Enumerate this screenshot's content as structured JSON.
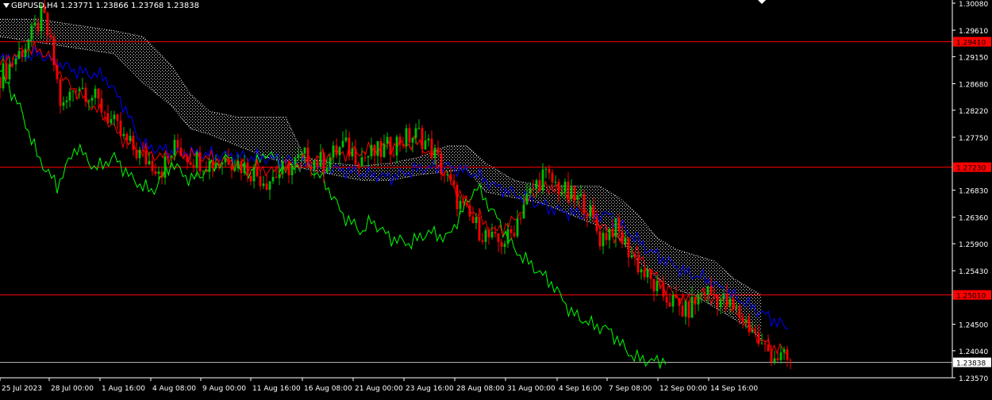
{
  "header": {
    "symbol": "GBPUSD,H4",
    "ohlc": "1.23771 1.23866 1.23768 1.23838"
  },
  "colors": {
    "background": "#000000",
    "bull_candle": "#00c000",
    "bear_candle": "#ff0000",
    "tenkan": "#ff0000",
    "kijun": "#0000ff",
    "chikou": "#00ff00",
    "kumo": "#ffffff",
    "hline": "#ff0000",
    "price_line": "#c0c0c0",
    "axis": "#ffffff"
  },
  "chart_data": {
    "type": "candlestick",
    "indicator": "Ichimoku Kinko Hyo",
    "ylim": [
      1.2357,
      1.3008
    ],
    "y_ticks": [
      {
        "value": 1.3008,
        "label": "1.30080"
      },
      {
        "value": 1.2961,
        "label": "1.29610"
      },
      {
        "value": 1.2915,
        "label": "1.29150"
      },
      {
        "value": 1.2868,
        "label": "1.28680"
      },
      {
        "value": 1.2822,
        "label": "1.28220"
      },
      {
        "value": 1.2775,
        "label": "1.27750"
      },
      {
        "value": 1.2683,
        "label": "1.26830"
      },
      {
        "value": 1.2636,
        "label": "1.26360"
      },
      {
        "value": 1.259,
        "label": "1.25900"
      },
      {
        "value": 1.2543,
        "label": "1.25430"
      },
      {
        "value": 1.245,
        "label": "1.24500"
      },
      {
        "value": 1.2404,
        "label": "1.24040"
      },
      {
        "value": 1.2357,
        "label": "1.23570"
      }
    ],
    "x_ticks": [
      "25 Jul 2023",
      "28 Jul 00:00",
      "1 Aug 16:00",
      "4 Aug 08:00",
      "9 Aug 00:00",
      "11 Aug 16:00",
      "16 Aug 08:00",
      "21 Aug 00:00",
      "23 Aug 16:00",
      "28 Aug 08:00",
      "31 Aug 00:00",
      "4 Sep 16:00",
      "7 Sep 08:00",
      "12 Sep 00:00",
      "14 Sep 16:00"
    ],
    "horizontal_lines": [
      {
        "value": 1.2941,
        "label": "1.29410"
      },
      {
        "value": 1.2723,
        "label": "1.27230"
      },
      {
        "value": 1.2501,
        "label": "1.25010"
      }
    ],
    "current_price": {
      "value": 1.23838,
      "label": "1.23838"
    },
    "close_path": [
      [
        0,
        1.288
      ],
      [
        0.02,
        1.292
      ],
      [
        0.035,
        1.2955
      ],
      [
        0.045,
        1.299
      ],
      [
        0.055,
        1.292
      ],
      [
        0.065,
        1.282
      ],
      [
        0.08,
        1.287
      ],
      [
        0.095,
        1.285
      ],
      [
        0.11,
        1.282
      ],
      [
        0.13,
        1.277
      ],
      [
        0.15,
        1.274
      ],
      [
        0.17,
        1.272
      ],
      [
        0.185,
        1.276
      ],
      [
        0.2,
        1.274
      ],
      [
        0.22,
        1.273
      ],
      [
        0.24,
        1.274
      ],
      [
        0.26,
        1.272
      ],
      [
        0.28,
        1.27
      ],
      [
        0.3,
        1.272
      ],
      [
        0.32,
        1.274
      ],
      [
        0.34,
        1.273
      ],
      [
        0.36,
        1.276
      ],
      [
        0.38,
        1.274
      ],
      [
        0.4,
        1.275
      ],
      [
        0.42,
        1.277
      ],
      [
        0.44,
        1.278
      ],
      [
        0.455,
        1.275
      ],
      [
        0.47,
        1.27
      ],
      [
        0.485,
        1.265
      ],
      [
        0.5,
        1.262
      ],
      [
        0.52,
        1.259
      ],
      [
        0.535,
        1.26
      ],
      [
        0.55,
        1.266
      ],
      [
        0.57,
        1.271
      ],
      [
        0.585,
        1.269
      ],
      [
        0.6,
        1.267
      ],
      [
        0.615,
        1.266
      ],
      [
        0.63,
        1.26
      ],
      [
        0.645,
        1.262
      ],
      [
        0.66,
        1.258
      ],
      [
        0.675,
        1.254
      ],
      [
        0.69,
        1.251
      ],
      [
        0.705,
        1.249
      ],
      [
        0.72,
        1.247
      ],
      [
        0.74,
        1.251
      ],
      [
        0.76,
        1.249
      ],
      [
        0.775,
        1.247
      ],
      [
        0.79,
        1.244
      ],
      [
        0.8,
        1.241
      ],
      [
        0.815,
        1.2395
      ],
      [
        0.83,
        1.2384
      ]
    ],
    "tenkan_path": [
      [
        0,
        1.29
      ],
      [
        0.03,
        1.293
      ],
      [
        0.05,
        1.292
      ],
      [
        0.07,
        1.287
      ],
      [
        0.09,
        1.284
      ],
      [
        0.11,
        1.281
      ],
      [
        0.13,
        1.277
      ],
      [
        0.15,
        1.275
      ],
      [
        0.17,
        1.274
      ],
      [
        0.2,
        1.2745
      ],
      [
        0.23,
        1.2735
      ],
      [
        0.26,
        1.2725
      ],
      [
        0.29,
        1.2715
      ],
      [
        0.32,
        1.2735
      ],
      [
        0.35,
        1.2745
      ],
      [
        0.38,
        1.275
      ],
      [
        0.41,
        1.276
      ],
      [
        0.44,
        1.2765
      ],
      [
        0.46,
        1.273
      ],
      [
        0.48,
        1.268
      ],
      [
        0.5,
        1.264
      ],
      [
        0.52,
        1.261
      ],
      [
        0.54,
        1.263
      ],
      [
        0.56,
        1.268
      ],
      [
        0.58,
        1.269
      ],
      [
        0.6,
        1.267
      ],
      [
        0.62,
        1.264
      ],
      [
        0.64,
        1.261
      ],
      [
        0.66,
        1.259
      ],
      [
        0.68,
        1.255
      ],
      [
        0.7,
        1.251
      ],
      [
        0.72,
        1.249
      ],
      [
        0.74,
        1.25
      ],
      [
        0.76,
        1.249
      ],
      [
        0.78,
        1.246
      ],
      [
        0.8,
        1.242
      ],
      [
        0.82,
        1.2405
      ],
      [
        0.83,
        1.2398
      ]
    ],
    "kijun_path": [
      [
        0,
        1.291
      ],
      [
        0.04,
        1.292
      ],
      [
        0.08,
        1.289
      ],
      [
        0.11,
        1.288
      ],
      [
        0.13,
        1.283
      ],
      [
        0.15,
        1.276
      ],
      [
        0.18,
        1.275
      ],
      [
        0.22,
        1.2745
      ],
      [
        0.27,
        1.274
      ],
      [
        0.3,
        1.2735
      ],
      [
        0.33,
        1.2725
      ],
      [
        0.37,
        1.2715
      ],
      [
        0.41,
        1.2705
      ],
      [
        0.44,
        1.272
      ],
      [
        0.47,
        1.2725
      ],
      [
        0.5,
        1.271
      ],
      [
        0.52,
        1.269
      ],
      [
        0.55,
        1.267
      ],
      [
        0.58,
        1.265
      ],
      [
        0.61,
        1.264
      ],
      [
        0.64,
        1.264
      ],
      [
        0.66,
        1.261
      ],
      [
        0.68,
        1.258
      ],
      [
        0.7,
        1.256
      ],
      [
        0.72,
        1.254
      ],
      [
        0.74,
        1.253
      ],
      [
        0.76,
        1.251
      ],
      [
        0.78,
        1.249
      ],
      [
        0.8,
        1.247
      ],
      [
        0.83,
        1.244
      ]
    ],
    "chikou_path": [
      [
        0,
        1.289
      ],
      [
        0.02,
        1.283
      ],
      [
        0.04,
        1.274
      ],
      [
        0.06,
        1.269
      ],
      [
        0.08,
        1.276
      ],
      [
        0.1,
        1.272
      ],
      [
        0.12,
        1.274
      ],
      [
        0.14,
        1.27
      ],
      [
        0.16,
        1.268
      ],
      [
        0.18,
        1.273
      ],
      [
        0.2,
        1.27
      ],
      [
        0.22,
        1.272
      ],
      [
        0.24,
        1.274
      ],
      [
        0.26,
        1.271
      ],
      [
        0.28,
        1.275
      ],
      [
        0.3,
        1.272
      ],
      [
        0.32,
        1.273
      ],
      [
        0.34,
        1.27
      ],
      [
        0.36,
        1.264
      ],
      [
        0.38,
        1.261
      ],
      [
        0.39,
        1.263
      ],
      [
        0.41,
        1.26
      ],
      [
        0.43,
        1.259
      ],
      [
        0.45,
        1.261
      ],
      [
        0.47,
        1.26
      ],
      [
        0.49,
        1.266
      ],
      [
        0.5,
        1.269
      ],
      [
        0.52,
        1.264
      ],
      [
        0.54,
        1.258
      ],
      [
        0.56,
        1.255
      ],
      [
        0.58,
        1.252
      ],
      [
        0.6,
        1.247
      ],
      [
        0.62,
        1.245
      ],
      [
        0.64,
        1.244
      ],
      [
        0.66,
        1.24
      ],
      [
        0.67,
        1.239
      ],
      [
        0.69,
        1.2385
      ],
      [
        0.7,
        1.239
      ]
    ],
    "kumo": [
      {
        "x": 0.0,
        "top": 1.298,
        "bottom": 1.295
      },
      {
        "x": 0.04,
        "top": 1.298,
        "bottom": 1.294
      },
      {
        "x": 0.08,
        "top": 1.297,
        "bottom": 1.293
      },
      {
        "x": 0.12,
        "top": 1.296,
        "bottom": 1.292
      },
      {
        "x": 0.15,
        "top": 1.295,
        "bottom": 1.287
      },
      {
        "x": 0.18,
        "top": 1.29,
        "bottom": 1.283
      },
      {
        "x": 0.2,
        "top": 1.285,
        "bottom": 1.279
      },
      {
        "x": 0.22,
        "top": 1.282,
        "bottom": 1.278
      },
      {
        "x": 0.25,
        "top": 1.281,
        "bottom": 1.276
      },
      {
        "x": 0.28,
        "top": 1.281,
        "bottom": 1.274
      },
      {
        "x": 0.3,
        "top": 1.281,
        "bottom": 1.273
      },
      {
        "x": 0.32,
        "top": 1.274,
        "bottom": 1.272
      },
      {
        "x": 0.35,
        "top": 1.273,
        "bottom": 1.271
      },
      {
        "x": 0.38,
        "top": 1.2725,
        "bottom": 1.27
      },
      {
        "x": 0.41,
        "top": 1.273,
        "bottom": 1.27
      },
      {
        "x": 0.44,
        "top": 1.274,
        "bottom": 1.271
      },
      {
        "x": 0.47,
        "top": 1.276,
        "bottom": 1.2715
      },
      {
        "x": 0.49,
        "top": 1.276,
        "bottom": 1.272
      },
      {
        "x": 0.51,
        "top": 1.273,
        "bottom": 1.268
      },
      {
        "x": 0.54,
        "top": 1.27,
        "bottom": 1.267
      },
      {
        "x": 0.57,
        "top": 1.269,
        "bottom": 1.266
      },
      {
        "x": 0.6,
        "top": 1.269,
        "bottom": 1.264
      },
      {
        "x": 0.63,
        "top": 1.269,
        "bottom": 1.262
      },
      {
        "x": 0.65,
        "top": 1.267,
        "bottom": 1.26
      },
      {
        "x": 0.67,
        "top": 1.264,
        "bottom": 1.256
      },
      {
        "x": 0.69,
        "top": 1.26,
        "bottom": 1.253
      },
      {
        "x": 0.71,
        "top": 1.258,
        "bottom": 1.251
      },
      {
        "x": 0.73,
        "top": 1.257,
        "bottom": 1.25
      },
      {
        "x": 0.75,
        "top": 1.256,
        "bottom": 1.248
      },
      {
        "x": 0.77,
        "top": 1.253,
        "bottom": 1.246
      },
      {
        "x": 0.79,
        "top": 1.251,
        "bottom": 1.244
      },
      {
        "x": 0.8,
        "top": 1.25,
        "bottom": 1.242
      }
    ]
  }
}
